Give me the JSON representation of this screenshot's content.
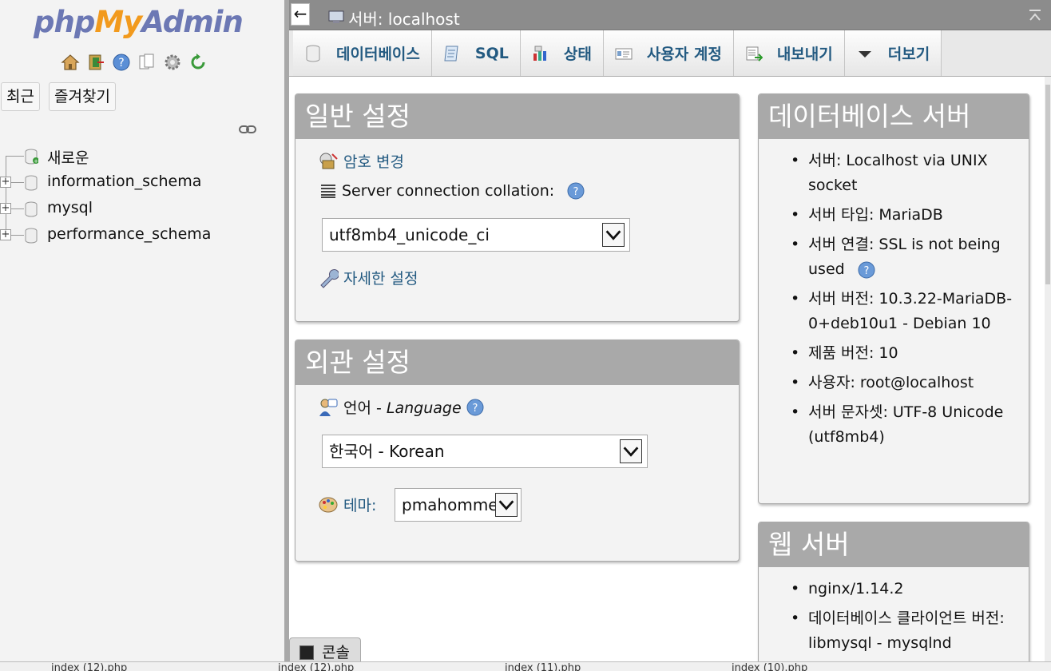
{
  "logo": {
    "php": "php",
    "my": "My",
    "admin": "Admin"
  },
  "nav": {
    "icons": [
      "home-icon",
      "exit-icon",
      "help-icon",
      "docs-icon",
      "settings-icon",
      "reload-icon"
    ],
    "recent_label": "최근",
    "favorites_label": "즐겨찾기",
    "tree": [
      {
        "label": "새로운",
        "type": "new"
      },
      {
        "label": "information_schema",
        "type": "db"
      },
      {
        "label": "mysql",
        "type": "db"
      },
      {
        "label": "performance_schema",
        "type": "db"
      }
    ]
  },
  "topbar": {
    "back": "←",
    "breadcrumb": "서버: localhost"
  },
  "tabs": [
    {
      "label": "데이터베이스",
      "icon": "database-icon"
    },
    {
      "label": "SQL",
      "icon": "sql-icon"
    },
    {
      "label": "상태",
      "icon": "status-icon"
    },
    {
      "label": "사용자 계정",
      "icon": "users-icon"
    },
    {
      "label": "내보내기",
      "icon": "export-icon"
    },
    {
      "label": "더보기",
      "icon": "more-icon"
    }
  ],
  "general_settings": {
    "title": "일반 설정",
    "change_password": "암호 변경",
    "collation_label": "Server connection collation:",
    "collation_value": "utf8mb4_unicode_ci",
    "more_settings": "자세한 설정"
  },
  "appearance_settings": {
    "title": "외관 설정",
    "language_label": "언어 - ",
    "language_label_en": "Language",
    "language_value": "한국어 - Korean",
    "theme_label": "테마:",
    "theme_value": "pmahomme"
  },
  "db_server": {
    "title": "데이터베이스 서버",
    "items": [
      "서버: Localhost via UNIX socket",
      "서버 타입: MariaDB",
      "서버 연결: SSL is not being used",
      "서버 버전: 10.3.22-MariaDB-0+deb10u1 - Debian 10",
      "제품 버전: 10",
      "사용자: root@localhost",
      "서버 문자셋: UTF-8 Unicode (utf8mb4)"
    ]
  },
  "web_server": {
    "title": "웹 서버",
    "items": [
      "nginx/1.14.2",
      "데이터베이스 클라이언트 버전: libmysql - mysqlnd"
    ]
  },
  "console": {
    "label": "콘솔"
  },
  "taskbar": [
    "index (12).php",
    "index (12).php",
    "index (11).php",
    "index (10).php"
  ]
}
